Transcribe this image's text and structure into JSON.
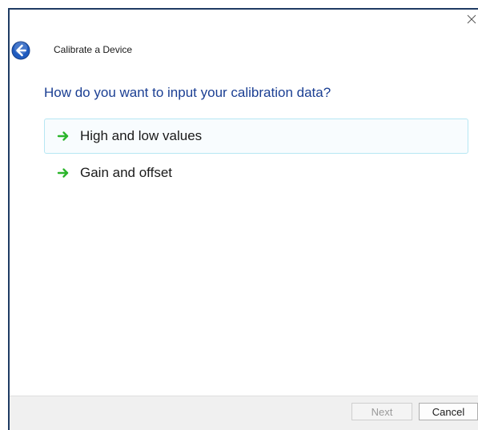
{
  "window": {
    "title": "Calibrate a Device"
  },
  "main": {
    "heading": "How do you want to input your calibration data?",
    "options": [
      {
        "label": "High and low values",
        "icon": "green-arrow-icon"
      },
      {
        "label": "Gain and offset",
        "icon": "green-arrow-icon"
      }
    ]
  },
  "footer": {
    "next_label": "Next",
    "cancel_label": "Cancel"
  },
  "colors": {
    "heading": "#1b3f93",
    "arrow": "#2bb52b",
    "hover_border": "#b6e7f3",
    "back_button": "#1f5bbf"
  }
}
